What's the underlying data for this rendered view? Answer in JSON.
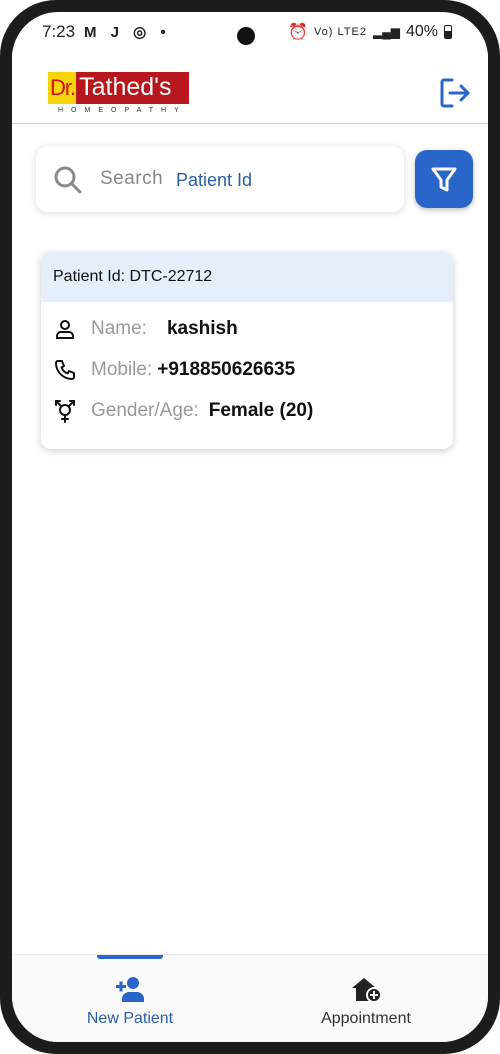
{
  "status_bar": {
    "time": "7:23",
    "left_icons": "M J ◎ •",
    "network": "Vo) LTE2",
    "battery": "40%"
  },
  "header": {
    "logo_dr": "Dr.",
    "logo_name": "Tathed's",
    "logo_sub": "HOMEOPATHY",
    "brand_red": "#b8161d",
    "brand_yellow": "#f5d40a"
  },
  "search": {
    "label": "Search",
    "placeholder": "Patient Id"
  },
  "patient": {
    "id_label": "Patient Id: DTC-22712",
    "name_label": "Name:",
    "name_value": "kashish",
    "mobile_label": "Mobile:",
    "mobile_value": "+918850626635",
    "gender_label": "Gender/Age:",
    "gender_value": "Female (20)"
  },
  "bottom_nav": {
    "new_patient": "New Patient",
    "appointment": "Appointment",
    "accent": "#2a66c9"
  }
}
